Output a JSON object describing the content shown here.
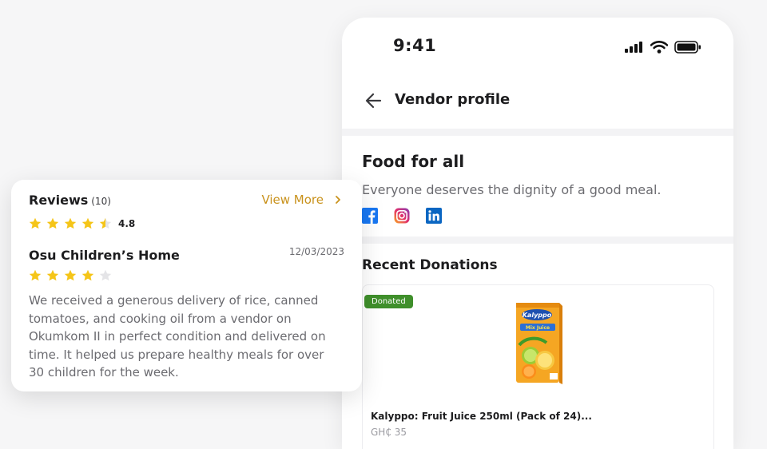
{
  "colors": {
    "accent": "#c9921c",
    "star": "#f5c518",
    "star_empty": "#e4e4e7",
    "badge": "#3f8f2b",
    "facebook": "#1877f2",
    "linkedin": "#0a66c2"
  },
  "phone": {
    "status_bar": {
      "time": "9:41",
      "icons": [
        "signal-icon",
        "wifi-icon",
        "battery-icon"
      ]
    },
    "header": {
      "back_icon": "arrow-left-icon",
      "title": "Vendor profile"
    },
    "vendor": {
      "name": "Food for all",
      "tagline": "Everyone deserves the dignity of a good meal.",
      "socials": [
        "facebook-icon",
        "instagram-icon",
        "linkedin-icon"
      ]
    },
    "recent_donations": {
      "title": "Recent Donations",
      "items": [
        {
          "badge": "Donated",
          "name": "Kalyppo: Fruit Juice 250ml (Pack of 24)...",
          "price": "GH₵ 35"
        }
      ]
    }
  },
  "reviews": {
    "title": "Reviews",
    "count": "(10)",
    "view_more": "View More",
    "rating": "4.8",
    "rating_stars": 4.5,
    "items": [
      {
        "reviewer": "Osu Children’s Home",
        "date": "12/03/2023",
        "stars": 4,
        "text": "We received a generous delivery of rice, canned tomatoes, and cooking oil from a vendor on Okumkom II in perfect condition and delivered on time. It helped us prepare healthy meals for over 30 children for the week."
      }
    ]
  }
}
